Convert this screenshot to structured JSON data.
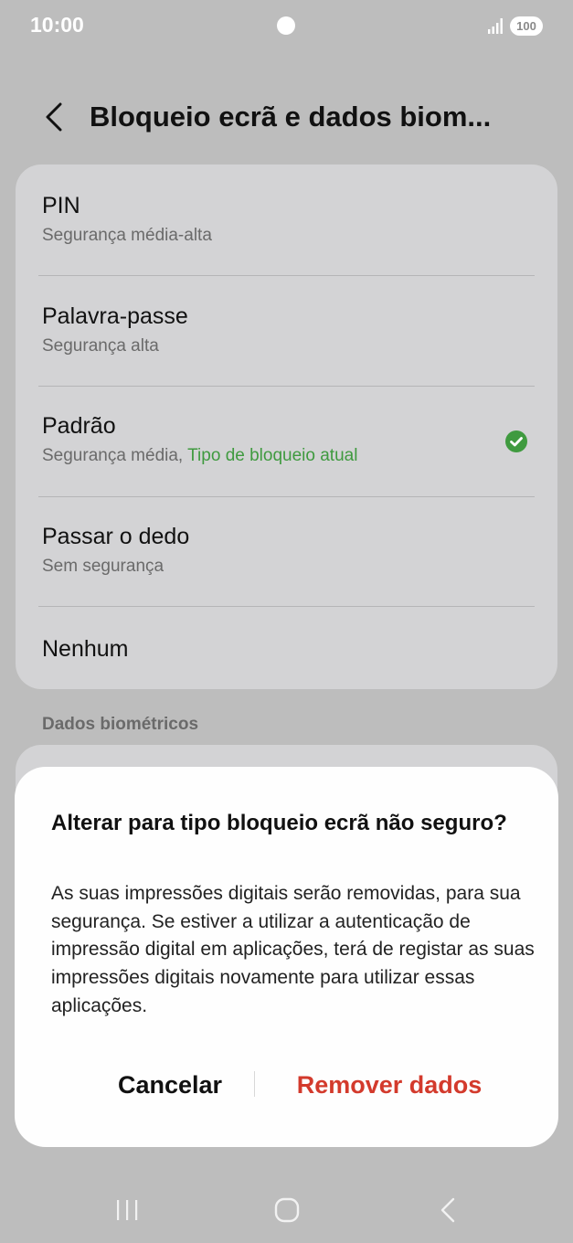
{
  "status_bar": {
    "time": "10:00",
    "battery": "100",
    "icons": [
      "signal-icon",
      "battery-icon",
      "camera-dot"
    ]
  },
  "header": {
    "back_icon": "chevron-left-icon",
    "title": "Bloqueio ecrã e dados biom..."
  },
  "options": [
    {
      "title": "PIN",
      "subtitle": "Segurança média-alta"
    },
    {
      "title": "Palavra-passe",
      "subtitle": "Segurança alta"
    },
    {
      "title": "Padrão",
      "subtitle": "Segurança média,",
      "current_label": "Tipo de bloqueio atual",
      "selected": true
    },
    {
      "title": "Passar o dedo",
      "subtitle": "Sem segurança"
    },
    {
      "title": "Nenhum",
      "subtitle": ""
    }
  ],
  "section": {
    "biometrics_label": "Dados biométricos"
  },
  "dialog": {
    "title": "Alterar para tipo bloqueio ecrã não seguro?",
    "body": "As suas impressões digitais serão removidas, para sua segurança. Se estiver a utilizar a autenticação de impressão digital em aplicações, terá de registar as suas impressões digitais novamente para utilizar essas aplicações.",
    "cancel_label": "Cancelar",
    "confirm_label": "Remover dados"
  },
  "nav_bar": {
    "icons": [
      "recents-icon",
      "home-icon",
      "back-icon"
    ]
  },
  "colors": {
    "accent_green": "#3f9a3f",
    "destructive_red": "#d33a2c",
    "dim_background": "#bdbdbd"
  }
}
